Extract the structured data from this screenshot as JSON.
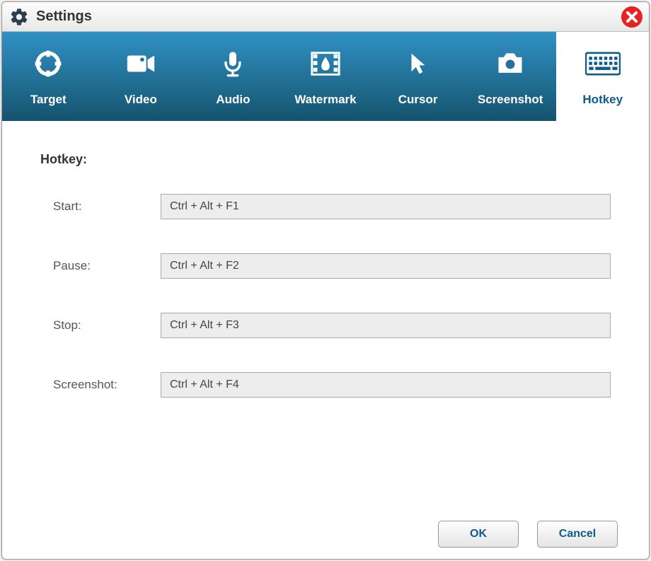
{
  "window": {
    "title": "Settings"
  },
  "tabs": [
    {
      "label": "Target",
      "icon": "target"
    },
    {
      "label": "Video",
      "icon": "video"
    },
    {
      "label": "Audio",
      "icon": "audio"
    },
    {
      "label": "Watermark",
      "icon": "watermark"
    },
    {
      "label": "Cursor",
      "icon": "cursor"
    },
    {
      "label": "Screenshot",
      "icon": "screenshot"
    },
    {
      "label": "Hotkey",
      "icon": "hotkey"
    }
  ],
  "active_tab_index": 6,
  "content": {
    "section_label": "Hotkey:",
    "rows": [
      {
        "label": "Start:",
        "value": "Ctrl + Alt + F1"
      },
      {
        "label": "Pause:",
        "value": "Ctrl + Alt + F2"
      },
      {
        "label": "Stop:",
        "value": "Ctrl + Alt + F3"
      },
      {
        "label": "Screenshot:",
        "value": "Ctrl + Alt + F4"
      }
    ]
  },
  "buttons": {
    "ok": "OK",
    "cancel": "Cancel"
  },
  "colors": {
    "accent": "#0d5c8a",
    "tab_bg_top": "#3091c4",
    "tab_bg_bottom": "#15536e",
    "close": "#e62222"
  }
}
